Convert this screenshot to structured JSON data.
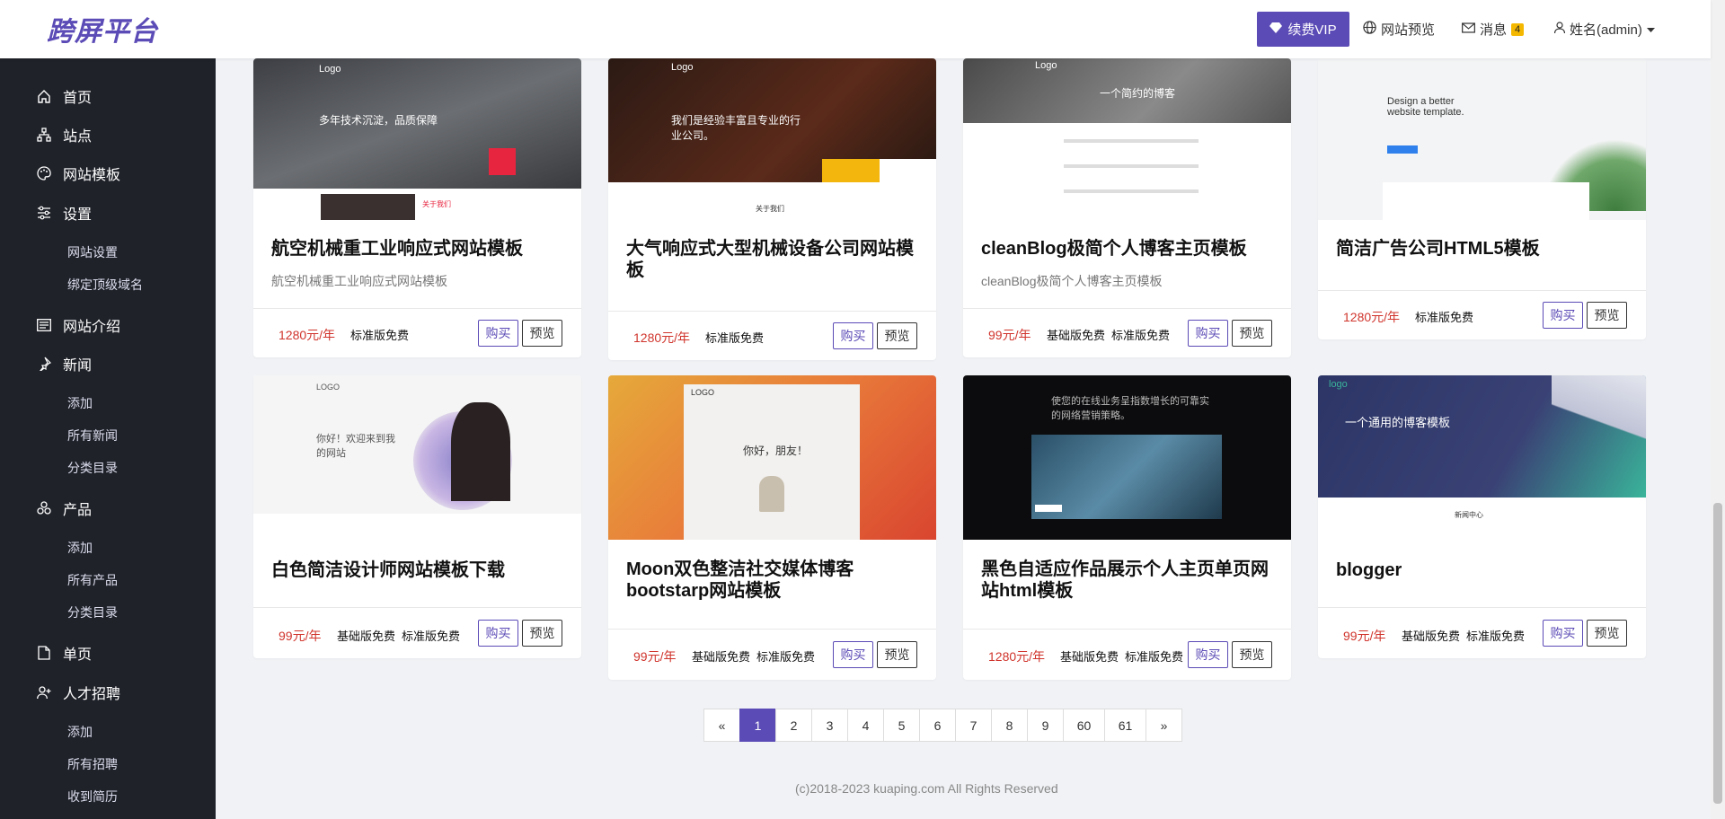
{
  "header": {
    "logo": "跨屏平台",
    "vip_label": "续费VIP",
    "preview_label": "网站预览",
    "messages_label": "消息",
    "messages_count": "4",
    "user_label": "姓名(admin)"
  },
  "sidebar": {
    "items": [
      {
        "label": "首页",
        "icon": "home-icon"
      },
      {
        "label": "站点",
        "icon": "sitemap-icon"
      },
      {
        "label": "网站模板",
        "icon": "palette-icon"
      },
      {
        "label": "设置",
        "icon": "sliders-icon"
      },
      {
        "label": "网站设置"
      },
      {
        "label": "绑定顶级域名"
      },
      {
        "label": "网站介绍",
        "icon": "newspaper-icon"
      },
      {
        "label": "新闻",
        "icon": "pin-icon"
      },
      {
        "label": "添加"
      },
      {
        "label": "所有新闻"
      },
      {
        "label": "分类目录"
      },
      {
        "label": "产品",
        "icon": "cubes-icon"
      },
      {
        "label": "添加"
      },
      {
        "label": "所有产品"
      },
      {
        "label": "分类目录"
      },
      {
        "label": "单页",
        "icon": "file-icon"
      },
      {
        "label": "人才招聘",
        "icon": "user-plus-icon"
      },
      {
        "label": "添加"
      },
      {
        "label": "所有招聘"
      },
      {
        "label": "收到简历"
      }
    ]
  },
  "cards": [
    {
      "title": "航空机械重工业响应式网站模板",
      "desc": "航空机械重工业响应式网站模板",
      "price": "1280元/年",
      "editions": [
        "标准版免费"
      ],
      "thumb": {
        "logo": "Logo",
        "headline": "多年技术沉淀，品质保障",
        "caption": "关于我们"
      }
    },
    {
      "title": "大气响应式大型机械设备公司网站模板",
      "desc": "",
      "price": "1280元/年",
      "editions": [
        "标准版免费"
      ],
      "thumb": {
        "logo": "Logo",
        "headline": "我们是经验丰富且专业的行业公司。",
        "caption": "关于我们"
      }
    },
    {
      "title": "cleanBlog极简个人博客主页模板",
      "desc": "cleanBlog极简个人博客主页模板",
      "price": "99元/年",
      "editions": [
        "基础版免费",
        "标准版免费"
      ],
      "thumb": {
        "logo": "Logo",
        "headline": "一个简约的博客"
      }
    },
    {
      "title": "简洁广告公司HTML5模板",
      "desc": "",
      "price": "1280元/年",
      "editions": [
        "标准版免费"
      ],
      "thumb": {
        "headline": "Design a better website template."
      }
    },
    {
      "title": "白色简洁设计师网站模板下载",
      "desc": "",
      "price": "99元/年",
      "editions": [
        "基础版免费",
        "标准版免费"
      ],
      "thumb": {
        "logo": "LOGO",
        "headline": "你好！欢迎来到我的网站"
      }
    },
    {
      "title": "Moon双色整洁社交媒体博客bootstarp网站模板",
      "desc": "",
      "price": "99元/年",
      "editions": [
        "基础版免费",
        "标准版免费"
      ],
      "thumb": {
        "logo": "LOGO",
        "headline": "你好，朋友！"
      }
    },
    {
      "title": "黑色自适应作品展示个人主页单页网站html模板",
      "desc": "",
      "price": "1280元/年",
      "editions": [
        "基础版免费",
        "标准版免费"
      ],
      "thumb": {
        "headline": "使您的在线业务呈指数增长的可靠实的网络营销策略。"
      }
    },
    {
      "title": "blogger",
      "desc": "",
      "price": "99元/年",
      "editions": [
        "基础版免费",
        "标准版免费"
      ],
      "thumb": {
        "logo": "logo",
        "headline": "一个通用的博客模板",
        "caption": "新闻中心"
      }
    }
  ],
  "buttons": {
    "buy": "购买",
    "preview": "预览"
  },
  "pagination": [
    "«",
    "1",
    "2",
    "3",
    "4",
    "5",
    "6",
    "7",
    "8",
    "9",
    "60",
    "61",
    "»"
  ],
  "pagination_active": "1",
  "footer": "(c)2018-2023 kuaping.com All Rights Reserved",
  "colors": {
    "accent": "#5b4bb6",
    "sidebar": "#1f2229",
    "price": "#d0342c"
  }
}
